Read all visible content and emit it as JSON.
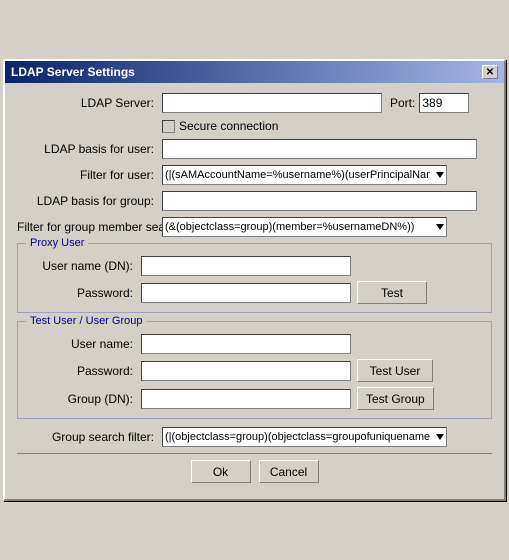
{
  "window": {
    "title": "LDAP Server Settings",
    "close_icon": "✕"
  },
  "form": {
    "ldap_server_label": "LDAP Server:",
    "ldap_server_value": "",
    "port_label": "Port:",
    "port_value": "389",
    "secure_label": "Secure connection",
    "ldap_basis_user_label": "LDAP basis for user:",
    "ldap_basis_user_value": "",
    "filter_user_label": "Filter for user:",
    "filter_user_value": "(|(sAMAccountName=%username%)(userPrincipalName=%",
    "ldap_basis_group_label": "LDAP basis for group:",
    "ldap_basis_group_value": "",
    "filter_group_label": "Filter for group member search:",
    "filter_group_value": "(&(objectclass=group)(member=%usernameDN%))"
  },
  "proxy_user": {
    "title": "Proxy User",
    "username_label": "User name (DN):",
    "username_value": "",
    "password_label": "Password:",
    "password_value": "",
    "test_button": "Test"
  },
  "test_section": {
    "title": "Test User / User Group",
    "username_label": "User name:",
    "username_value": "",
    "password_label": "Password:",
    "password_value": "",
    "test_user_button": "Test User",
    "group_label": "Group (DN):",
    "group_value": "",
    "test_group_button": "Test Group"
  },
  "group_search": {
    "label": "Group search filter:",
    "value": "(|(objectclass=group)(objectclass=groupofuniquenames))"
  },
  "buttons": {
    "ok": "Ok",
    "cancel": "Cancel"
  }
}
